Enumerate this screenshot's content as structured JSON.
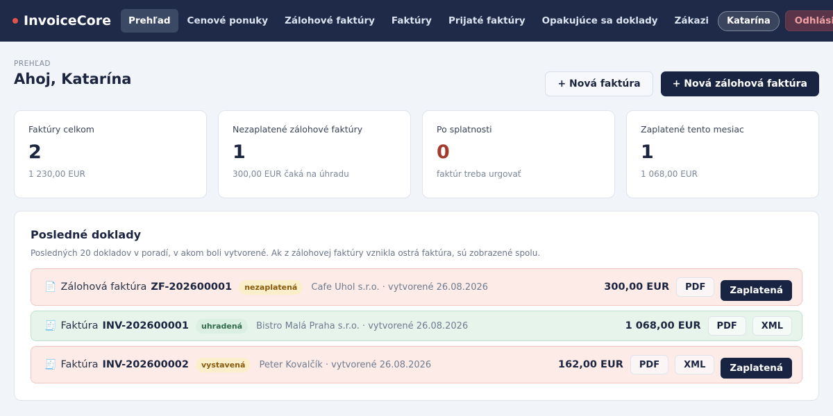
{
  "nav": {
    "brand": "InvoiceCore",
    "items": [
      {
        "label": "Prehľad",
        "active": true
      },
      {
        "label": "Cenové ponuky"
      },
      {
        "label": "Zálohové faktúry"
      },
      {
        "label": "Faktúry"
      },
      {
        "label": "Prijaté faktúry"
      },
      {
        "label": "Opakujúce sa doklady"
      },
      {
        "label": "Zákazi"
      }
    ],
    "user": "Katarína",
    "logout": "Odhlásiť"
  },
  "header": {
    "breadcrumb": "PREHĽAD",
    "title": "Ahoj, Katarína",
    "new_invoice": "+ Nová faktúra",
    "new_proforma": "+ Nová zálohová faktúra"
  },
  "stats": [
    {
      "label": "Faktúry celkom",
      "value": "2",
      "sub": "1 230,00 EUR"
    },
    {
      "label": "Nezaplatené zálohové faktúry",
      "value": "1",
      "sub": "300,00 EUR čaká na úhradu"
    },
    {
      "label": "Po splatnosti",
      "value": "0",
      "sub": "faktúr treba urgovať"
    },
    {
      "label": "Zaplatené tento mesiac",
      "value": "1",
      "sub": "1 068,00 EUR"
    }
  ],
  "recent": {
    "title": "Posledné doklady",
    "description": "Posledných 20 dokladov v poradí, v akom boli vytvorené. Ak z zálohovej faktúry vznikla ostrá faktúra, sú zobrazené spolu.",
    "docs": [
      {
        "icon": "📄",
        "type": "Zálohová faktúra",
        "number": "ZF-202600001",
        "status": "nezaplatená",
        "meta": "Cafe Uhol s.r.o. · vytvorené 26.08.2026",
        "amount": "300,00 EUR",
        "pdf": "PDF",
        "paid": "Zaplatená"
      },
      {
        "icon": "🧾",
        "type": "Faktúra",
        "number": "INV-202600001",
        "status": "uhradená",
        "meta": "Bistro Malá Praha s.r.o. · vytvorené 26.08.2026",
        "amount": "1 068,00 EUR",
        "pdf": "PDF",
        "xml": "XML"
      },
      {
        "icon": "🧾",
        "type": "Faktúra",
        "number": "INV-202600002",
        "status": "vystavená",
        "meta": "Peter Kovalčík · vytvorené 26.08.2026",
        "amount": "162,00 EUR",
        "pdf": "PDF",
        "xml": "XML",
        "paid": "Zaplatená"
      }
    ]
  },
  "colors": {
    "nav_bg": "#1e2a48",
    "primary": "#182442",
    "danger": "#a33a2e",
    "row_pink": "#fdebe7",
    "row_green": "#e6f4ec"
  }
}
